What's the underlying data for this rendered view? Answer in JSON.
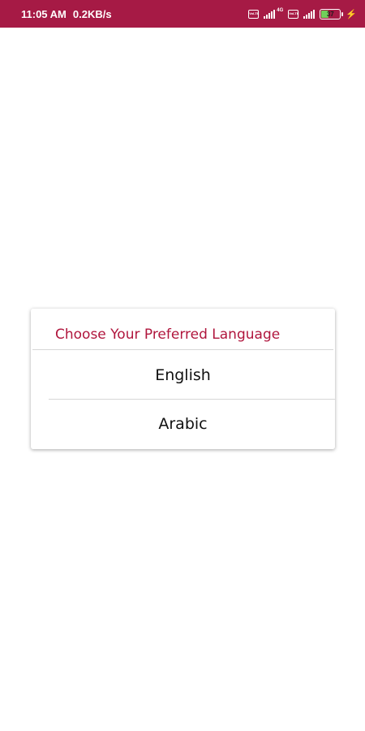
{
  "status_bar": {
    "time": "11:05 AM",
    "speed": "0.2KB/s",
    "sim1_label": "VoLTE",
    "sim2_label": "VoLTE",
    "network_type": "4G",
    "battery_level": "37",
    "battery_percent": 0.37,
    "background_color": "#a61a45"
  },
  "dialog": {
    "title": "Choose Your Preferred Language",
    "title_color": "#b0163d",
    "options": [
      {
        "label": "English"
      },
      {
        "label": "Arabic"
      }
    ]
  }
}
